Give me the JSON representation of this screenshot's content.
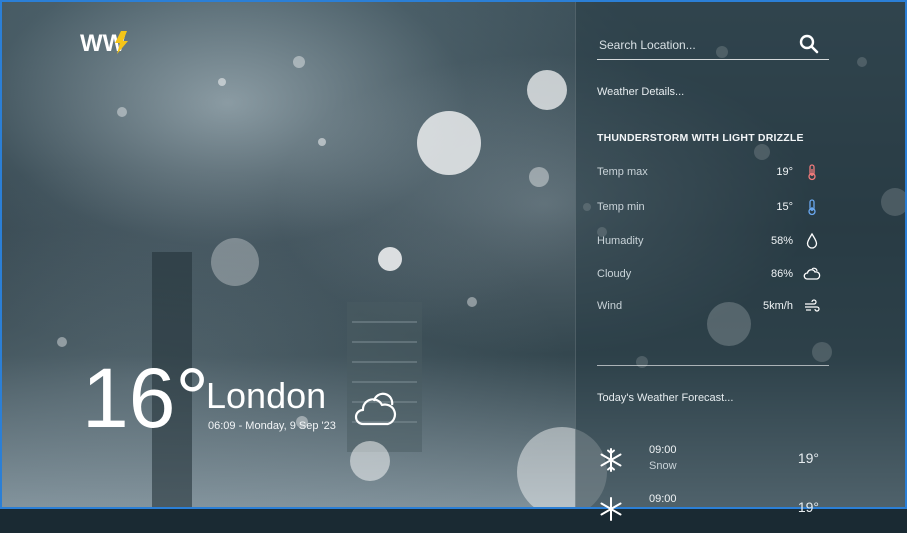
{
  "brand": {
    "logo_text": "WW"
  },
  "search": {
    "placeholder": "Search Location..."
  },
  "details": {
    "heading": "Weather Details...",
    "condition": "THUNDERSTORM WITH LIGHT DRIZZLE",
    "rows": [
      {
        "label": "Temp max",
        "value": "19°",
        "icon": "thermometer-hot-icon"
      },
      {
        "label": "Temp min",
        "value": "15°",
        "icon": "thermometer-cold-icon"
      },
      {
        "label": "Humadity",
        "value": "58%",
        "icon": "droplet-icon"
      },
      {
        "label": "Cloudy",
        "value": "86%",
        "icon": "cloud-sun-icon"
      },
      {
        "label": "Wind",
        "value": "5km/h",
        "icon": "wind-icon"
      }
    ]
  },
  "forecast": {
    "heading": "Today's Weather Forecast...",
    "items": [
      {
        "time": "09:00",
        "desc": "Snow",
        "temp": "19°",
        "icon": "snowflake-icon"
      },
      {
        "time": "09:00",
        "desc": "",
        "temp": "19°",
        "icon": "snowflake-icon"
      }
    ]
  },
  "current": {
    "temperature": "16°",
    "city": "London",
    "datetime": "06:09 - Monday, 9 Sep '23",
    "icon": "cloud-icon"
  },
  "colors": {
    "accent_border": "#2b7fd6",
    "temp_max_icon": "#f07a7a",
    "temp_min_icon": "#6aa8f0",
    "logo_yellow": "#f5c518"
  }
}
